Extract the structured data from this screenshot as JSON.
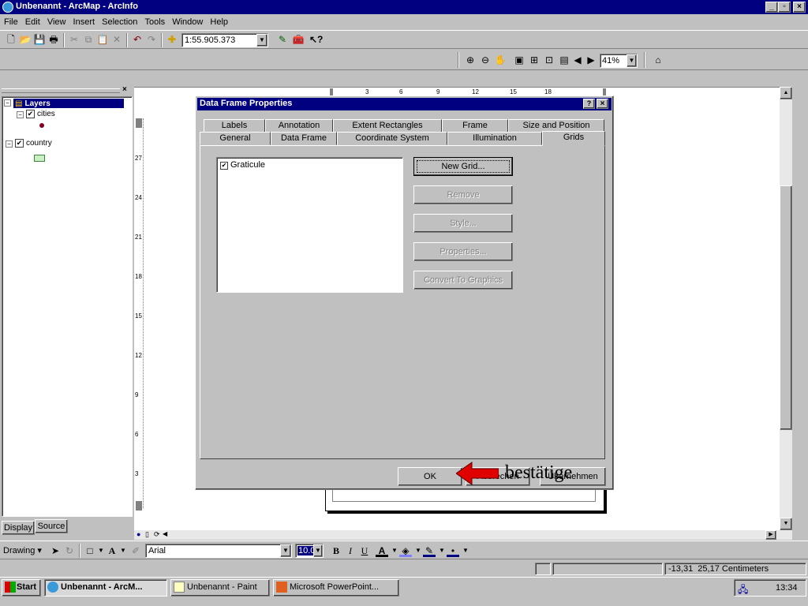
{
  "window": {
    "title": "Unbenannt - ArcMap - ArcInfo"
  },
  "menu": [
    "File",
    "Edit",
    "View",
    "Insert",
    "Selection",
    "Tools",
    "Window",
    "Help"
  ],
  "toolbar": {
    "scale": "1:55.905.373",
    "zoom": "41%"
  },
  "toc": {
    "root": "Layers",
    "layers": [
      {
        "name": "cities",
        "checked": true
      },
      {
        "name": "country",
        "checked": true
      }
    ],
    "tabs": [
      "Display",
      "Source"
    ]
  },
  "ruler": {
    "h_labels": [
      "3",
      "6",
      "9",
      "12",
      "15",
      "18"
    ],
    "v_labels": [
      "27",
      "24",
      "21",
      "18",
      "15",
      "12",
      "9",
      "6",
      "3"
    ]
  },
  "dialog": {
    "title": "Data Frame Properties",
    "tabs_back": [
      "Labels",
      "Annotation",
      "Extent Rectangles",
      "Frame",
      "Size and Position"
    ],
    "tabs_front": [
      "General",
      "Data Frame",
      "Coordinate System",
      "Illumination",
      "Grids"
    ],
    "grid_list": [
      {
        "label": "Graticule",
        "checked": true
      }
    ],
    "buttons": {
      "new_grid": "New Grid...",
      "remove": "Remove",
      "style": "Style...",
      "properties": "Properties...",
      "convert": "Convert To Graphics"
    },
    "footer": {
      "ok": "OK",
      "cancel": "Abbrechen",
      "apply": "Übernehmen"
    }
  },
  "annotation": {
    "text": "bestätige"
  },
  "drawing_toolbar": {
    "label": "Drawing",
    "font": "Arial",
    "size": "10.0"
  },
  "statusbar": {
    "coords": "-13,31  25,17 Centimeters"
  },
  "taskbar": {
    "start": "Start",
    "items": [
      "Unbenannt - ArcM...",
      "Unbenannt - Paint",
      "Microsoft PowerPoint..."
    ],
    "clock": "13:34"
  },
  "colors": {
    "titlebar": "#000080",
    "face": "#c0c0c0",
    "arrow": "#e00000"
  }
}
